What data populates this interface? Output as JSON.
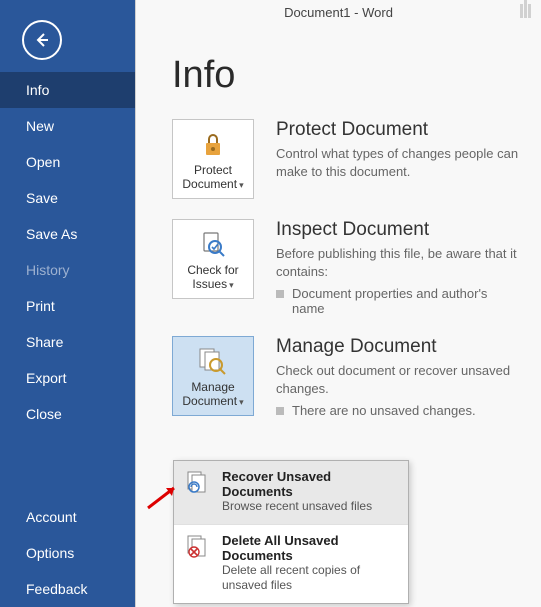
{
  "header": {
    "doc_title": "Document1 - Word"
  },
  "sidebar": {
    "items": [
      {
        "label": "Info",
        "active": true
      },
      {
        "label": "New"
      },
      {
        "label": "Open"
      },
      {
        "label": "Save"
      },
      {
        "label": "Save As"
      },
      {
        "label": "History",
        "disabled": true
      },
      {
        "label": "Print"
      },
      {
        "label": "Share"
      },
      {
        "label": "Export"
      },
      {
        "label": "Close"
      }
    ],
    "bottom": [
      {
        "label": "Account"
      },
      {
        "label": "Options"
      },
      {
        "label": "Feedback"
      }
    ]
  },
  "page": {
    "heading": "Info",
    "sections": {
      "protect": {
        "button_line1": "Protect",
        "button_line2": "Document",
        "title": "Protect Document",
        "desc": "Control what types of changes people can make to this document."
      },
      "inspect": {
        "button_line1": "Check for",
        "button_line2": "Issues",
        "title": "Inspect Document",
        "desc": "Before publishing this file, be aware that it contains:",
        "bullet1": "Document properties and author's name"
      },
      "manage": {
        "button_line1": "Manage",
        "button_line2": "Document",
        "title": "Manage Document",
        "desc": "Check out document or recover unsaved changes.",
        "bullet1": "There are no unsaved changes."
      }
    },
    "menu": {
      "recover": {
        "title": "Recover Unsaved Documents",
        "sub": "Browse recent unsaved files"
      },
      "delete": {
        "title": "Delete All Unsaved Documents",
        "sub": "Delete all recent copies of unsaved files"
      }
    }
  }
}
